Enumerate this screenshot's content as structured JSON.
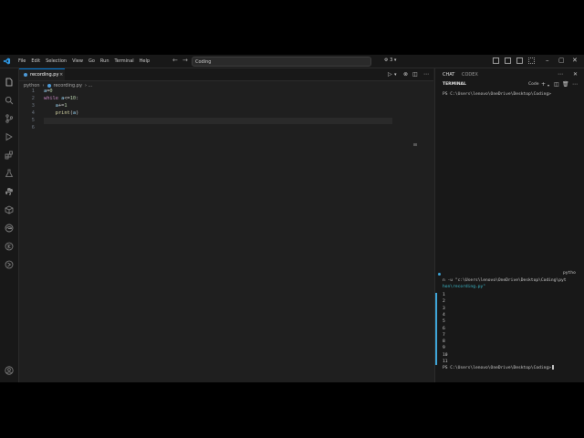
{
  "menu": [
    "File",
    "Edit",
    "Selection",
    "View",
    "Go",
    "Run",
    "Terminal",
    "Help"
  ],
  "search_text": "Coding",
  "copilot_count": "3",
  "tab": {
    "label": "recording.py",
    "close": "×"
  },
  "breadcrumb": {
    "folder": "python",
    "sep": "›",
    "file": "recording.py",
    "tail": "› ..."
  },
  "code_lines": [
    {
      "n": "1",
      "parts": [
        [
          "var",
          "a"
        ],
        [
          "op",
          "=0"
        ]
      ]
    },
    {
      "n": "2",
      "parts": [
        [
          "kw",
          "while "
        ],
        [
          "var",
          "a"
        ],
        [
          "op",
          "<=10:"
        ]
      ]
    },
    {
      "n": "3",
      "parts": [
        [
          "op",
          "    "
        ],
        [
          "var",
          "a"
        ],
        [
          "op",
          "+=1"
        ]
      ]
    },
    {
      "n": "4",
      "parts": [
        [
          "op",
          "    "
        ],
        [
          "fn",
          "print"
        ],
        [
          "op",
          "("
        ],
        [
          "var",
          "a"
        ],
        [
          "op",
          ")"
        ]
      ]
    },
    {
      "n": "5",
      "parts": []
    },
    {
      "n": "6",
      "parts": []
    }
  ],
  "panel": {
    "tab_chat": "CHAT",
    "tab_codex": "CODEX",
    "terminal_title": "TERMINAL",
    "terminal_shell": "Code"
  },
  "terminal": {
    "prompt1": "PS C:\\Users\\lenovo\\OneDrive\\Desktop\\Coding>",
    "cmd_tail": "pytho",
    "cmd_line1": "n -u \"c:\\Users\\lenovo\\OneDrive\\Desktop\\Coding\\pyt",
    "cmd_line2": "hon\\recording.py\"",
    "output": [
      "1",
      "2",
      "3",
      "4",
      "5",
      "6",
      "7",
      "8",
      "9",
      "10",
      "11"
    ],
    "prompt2": "PS C:\\Users\\lenovo\\OneDrive\\Desktop\\Coding>"
  },
  "colors": {
    "accent": "#0078d4",
    "editor_bg": "#1f1f1f",
    "sidebar_bg": "#181818",
    "terminal_cyan": "#3ebfd0"
  }
}
